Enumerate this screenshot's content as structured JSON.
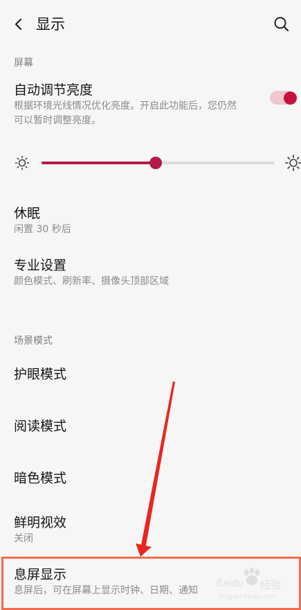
{
  "header": {
    "title": "显示",
    "back_icon": "chevron-left-icon",
    "search_icon": "search-icon"
  },
  "sections": {
    "screen": "屏幕",
    "scene_modes": "场景模式"
  },
  "auto_brightness": {
    "title": "自动调节亮度",
    "description_line1": "根据环境光线情况优化亮度。开启此功能后，您仍然",
    "description_line2": "可以暂时调整亮度。",
    "enabled": true
  },
  "brightness": {
    "level": 0.49,
    "low_icon": "sun-low-icon",
    "high_icon": "sun-high-icon"
  },
  "sleep": {
    "title": "休眠",
    "subtitle": "闲置 30 秒后"
  },
  "advanced": {
    "title": "专业设置",
    "subtitle": "颜色模式、刷新率、摄像头顶部区域"
  },
  "eye_care": {
    "title": "护眼模式"
  },
  "reading": {
    "title": "阅读模式"
  },
  "dark": {
    "title": "暗色模式"
  },
  "vivid": {
    "title": "鲜明视效",
    "subtitle": "关闭"
  },
  "ambient": {
    "title": "息屏显示",
    "subtitle": "息屏后，可在屏幕上显示时钟、日期、通知"
  },
  "colors": {
    "accent": "#c2133e",
    "toggle_track": "#f0c6d0",
    "highlight": "#f26a4f",
    "arrow": "#e8261f"
  },
  "watermark": {
    "brand": "Baidu",
    "label": "经验",
    "url": "jingyan.baidu.com"
  }
}
